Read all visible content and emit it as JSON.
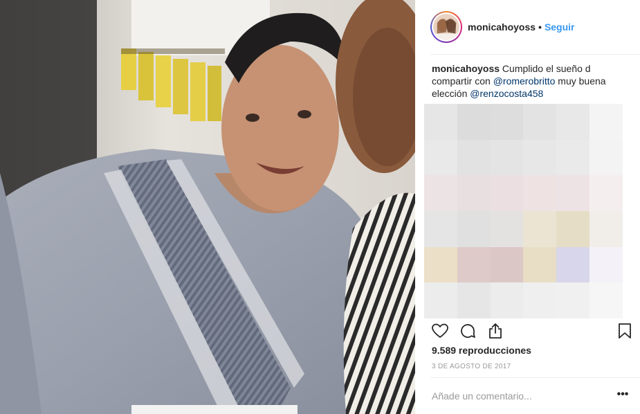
{
  "post": {
    "username": "monicahoyoss",
    "separator": "•",
    "follow_label": "Seguir",
    "caption": {
      "username": "monicahoyoss",
      "text_1": " Cumplido el sueño d compartir con ",
      "mention_1": "@romerobritto",
      "text_2": " muy buena elección ",
      "mention_2": "@renzocosta458"
    },
    "views_count": "9.589",
    "views_label": " reproducciones",
    "date": "3 DE AGOSTO DE 2017",
    "comment_placeholder": "Añade un comentario...",
    "more_label": "•••"
  },
  "icons": {
    "like": "heart-icon",
    "comment": "comment-bubble-icon",
    "share": "share-icon",
    "save": "bookmark-icon",
    "more": "more-options-icon"
  },
  "colors": {
    "follow_blue": "#3897f0",
    "mention_blue": "#003569",
    "muted_gray": "#999999",
    "text_dark": "#262626"
  },
  "blur_colors": [
    "#e6e6e6",
    "#dcdcdc",
    "#dddddd",
    "#e3e3e3",
    "#e8e8e8",
    "#f4f4f4",
    "#e9e9e9",
    "#e2e2e2",
    "#e4e4e4",
    "#e8e7e8",
    "#ebeaeb",
    "#f3f3f4",
    "#ece3e4",
    "#e8dfe0",
    "#ecdfe1",
    "#eee2e3",
    "#eee3e4",
    "#f5eeee",
    "#e5e5e5",
    "#e0e0e0",
    "#e4e2e0",
    "#ebe4d3",
    "#e6ddc6",
    "#f1eeea",
    "#ebdfc7",
    "#decac8",
    "#dcc7c7",
    "#e8dec6",
    "#d8d6ea",
    "#f4f1f8",
    "#ececec",
    "#e6e6e6",
    "#ececec",
    "#efefef",
    "#f0f0f0",
    "#f6f6f6"
  ]
}
